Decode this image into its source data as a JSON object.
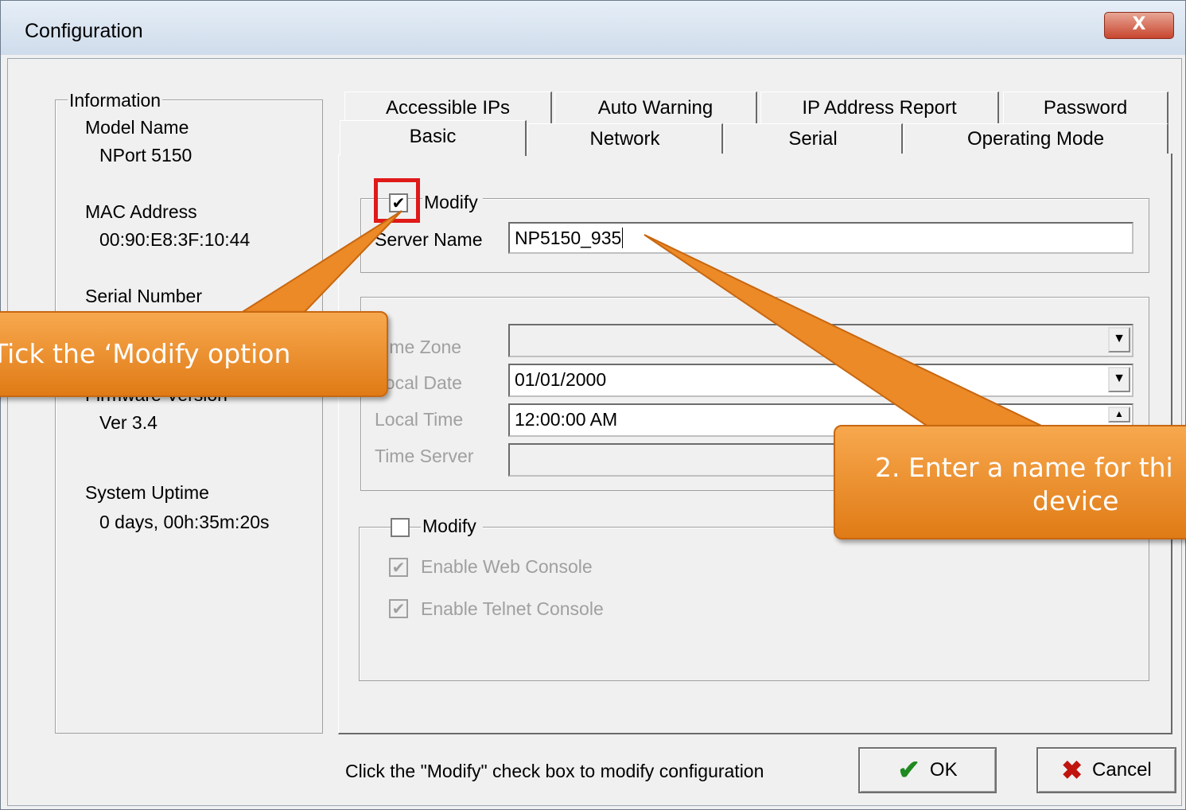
{
  "window": {
    "title": "Configuration",
    "close_label": "X"
  },
  "info": {
    "group_label": "Information",
    "model_name_label": "Model Name",
    "model_name_value": "NPort 5150",
    "mac_label": "MAC Address",
    "mac_value": "00:90:E8:3F:10:44",
    "serial_label": "Serial Number",
    "firmware_label": "Firmware Version",
    "firmware_value": "Ver 3.4",
    "uptime_label": "System Uptime",
    "uptime_value": "0 days, 00h:35m:20s"
  },
  "tabs": {
    "row_back": [
      "Accessible IPs",
      "Auto Warning",
      "IP Address Report",
      "Password"
    ],
    "row_front": [
      "Basic",
      "Network",
      "Serial",
      "Operating Mode"
    ]
  },
  "basic": {
    "modify_label": "Modify",
    "modify_checked": true,
    "server_name_label": "Server Name",
    "server_name_value": "NP5150_935",
    "time_zone_label": "Time Zone",
    "time_zone_value": "",
    "local_date_label": "Local Date",
    "local_date_value": "01/01/2000",
    "local_time_label": "Local Time",
    "local_time_value": "12:00:00 AM",
    "time_server_label": "Time Server",
    "time_server_value": "",
    "modify2_label": "Modify",
    "web_console_label": "Enable Web Console",
    "telnet_console_label": "Enable Telnet Console"
  },
  "footer": {
    "hint": "Click the \"Modify\" check box to modify configuration",
    "ok_label": "OK",
    "cancel_label": "Cancel"
  },
  "callouts": {
    "one": "Tick the ‘Modify option",
    "two_line1": "2. Enter a name for thi",
    "two_line2": "device"
  },
  "colors": {
    "callout_fill": "#ef8f2c",
    "highlight_box": "#e01919"
  }
}
